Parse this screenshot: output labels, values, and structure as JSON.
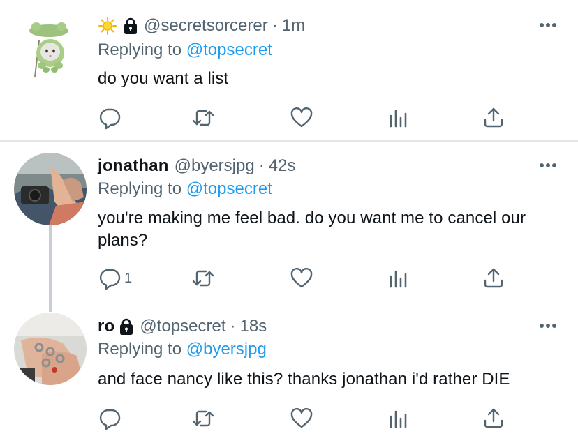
{
  "tweets": [
    {
      "display_name": "",
      "handle": "@secretsorcerer",
      "separator": "·",
      "time": "1m",
      "replying_prefix": "Replying to",
      "replying_to": "@topsecret",
      "text": "do you want a list",
      "reply_count": "",
      "has_emoji": true,
      "protected": true,
      "avatar": "frog-plush"
    },
    {
      "display_name": "jonathan",
      "handle": "@byersjpg",
      "separator": "·",
      "time": "42s",
      "replying_prefix": "Replying to",
      "replying_to": "@topsecret",
      "text": "you're making me feel bad. do you want me to cancel our plans?",
      "reply_count": "1",
      "has_emoji": false,
      "protected": false,
      "avatar": "hands-camera-photo"
    },
    {
      "display_name": "ro",
      "handle": "@topsecret",
      "separator": "·",
      "time": "18s",
      "replying_prefix": "Replying to",
      "replying_to": "@byersjpg",
      "text": "and face nancy like this? thanks jonathan i'd rather DIE",
      "reply_count": "",
      "has_emoji": false,
      "protected": true,
      "avatar": "hands-rings-photo"
    }
  ],
  "icons": {
    "emoji": "sun-icon",
    "protected": "lock-icon",
    "more": "more-icon",
    "reply": "reply-icon",
    "retweet": "retweet-icon",
    "like": "like-icon",
    "views": "views-icon",
    "share": "share-icon"
  },
  "colors": {
    "mention": "#1d9bf0",
    "secondary_text": "#536471",
    "icon": "#536471",
    "primary_text": "#0f1419",
    "divider": "#e3e6e8",
    "thread_line": "#c8ced3"
  }
}
